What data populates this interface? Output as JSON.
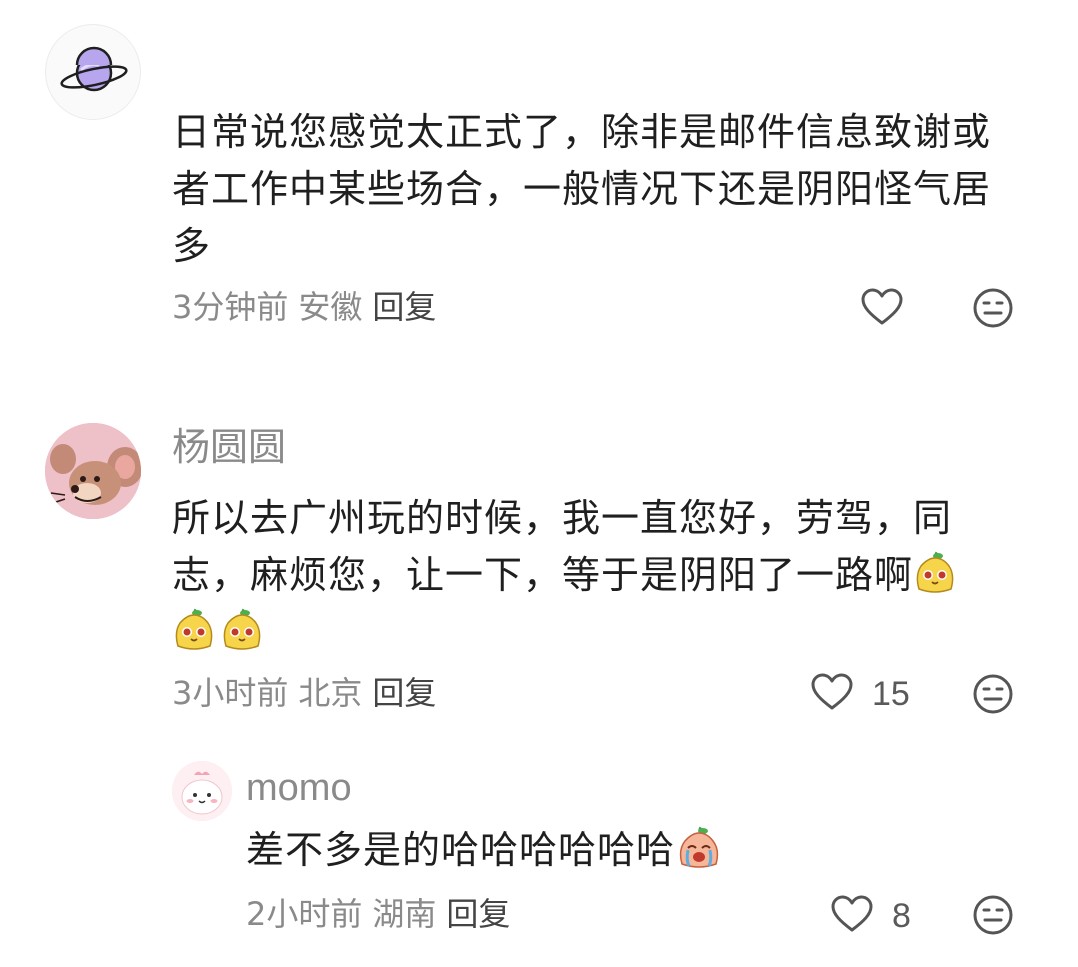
{
  "comments": [
    {
      "text": "日常说您感觉太正式了，除非是邮件信息致谢或者工作中某些场合，一般情况下还是阴阳怪气居多",
      "time": "3分钟前",
      "location": "安徽",
      "reply_label": "回复"
    },
    {
      "username": "杨圆圆",
      "text": "所以去广州玩的时候，我一直您好，劳驾，同志，麻烦您，让一下，等于是阴阳了一路啊",
      "time": "3小时前",
      "location": "北京",
      "reply_label": "回复",
      "likes": "15"
    }
  ],
  "reply": {
    "username": "momo",
    "text": "差不多是的哈哈哈哈哈哈",
    "time": "2小时前",
    "location": "湖南",
    "reply_label": "回复",
    "likes": "8"
  },
  "icons": {
    "like": "heart-outline-icon",
    "dislike": "neutral-face-icon",
    "emoji_sticker": "yellow-blob-emoji",
    "emoji_laugh": "laughing-crying-emoji"
  },
  "colors": {
    "text": "#1f1f1f",
    "meta": "#8a8a8a",
    "icon": "#555555"
  }
}
